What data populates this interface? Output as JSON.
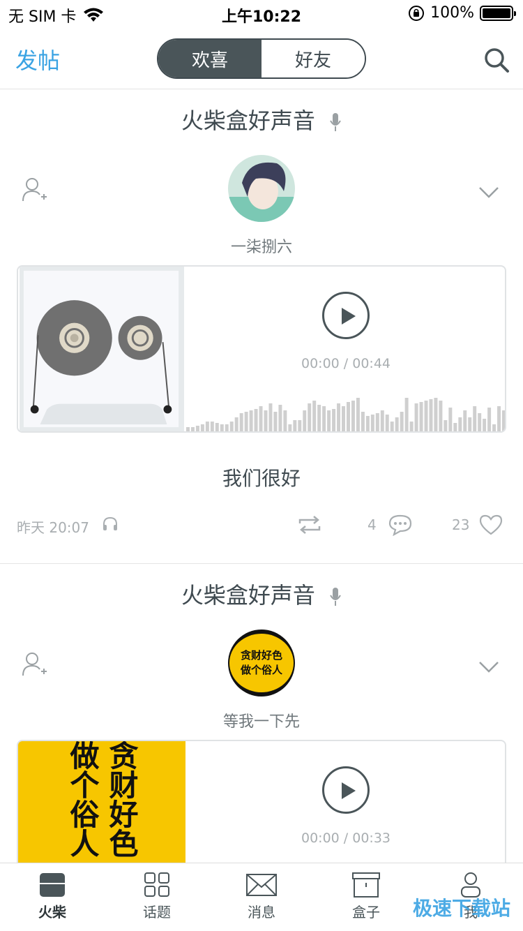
{
  "status_bar": {
    "carrier": "无 SIM 卡",
    "time": "上午10:22",
    "battery": "100%"
  },
  "nav": {
    "post_label": "发帖",
    "tabs": [
      {
        "label": "欢喜",
        "active": true
      },
      {
        "label": "好友",
        "active": false
      }
    ]
  },
  "posts": [
    {
      "channel": "火柴盒好声音",
      "username": "一柒捌六",
      "elapsed": "00:00",
      "duration": "00:44",
      "time_text": "00:00 / 00:44",
      "caption": "我们很好",
      "date": "昨天 20:07",
      "comments": "4",
      "likes": "23"
    },
    {
      "channel": "火柴盒好声音",
      "username": "等我一下先",
      "avatar_text": "贪财好色 做个俗人",
      "cover_text": "贪财好色 做个俗人",
      "time_text": "00:00 / 00:33"
    }
  ],
  "tabbar": {
    "items": [
      {
        "label": "火柴",
        "active": true
      },
      {
        "label": "话题",
        "active": false
      },
      {
        "label": "消息",
        "active": false
      },
      {
        "label": "盒子",
        "active": false
      },
      {
        "label": "我",
        "active": false
      }
    ]
  },
  "watermark": "极速下载站",
  "colors": {
    "accent": "#3aa3e3",
    "dark": "#4a5559",
    "cover_yellow": "#f7c600"
  }
}
